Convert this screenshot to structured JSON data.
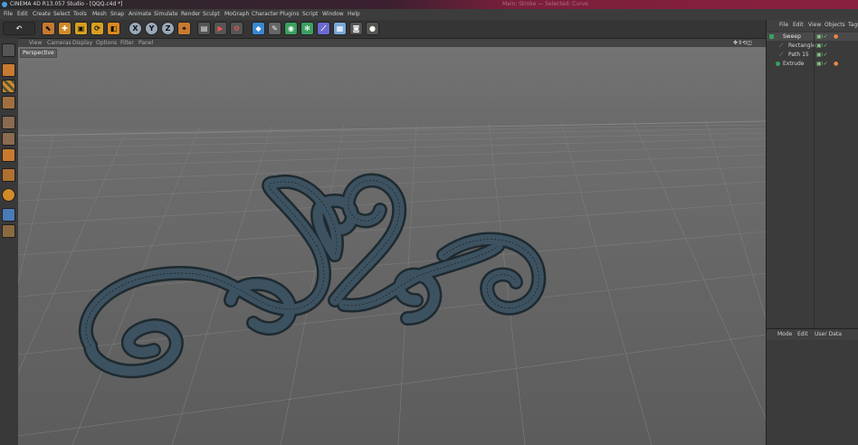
{
  "window": {
    "title": "CINEMA 4D R13.057 Studio - [QQQ.c4d *]",
    "center_title": "Main: Stroke — Selected: Curve"
  },
  "menu": [
    "File",
    "Edit",
    "Create",
    "Select",
    "Tools",
    "Mesh",
    "Snap",
    "Animate",
    "Simulate",
    "Render",
    "Sculpt",
    "MoGraph",
    "Character",
    "Plugins",
    "Script",
    "Window",
    "Help"
  ],
  "toolbar": {
    "axis_x": "X",
    "axis_y": "Y",
    "axis_z": "Z"
  },
  "viewport": {
    "menu": [
      "View",
      "Cameras",
      "Display",
      "Options",
      "Filter",
      "Panel"
    ],
    "camera_label": "Perspective"
  },
  "object_manager": {
    "menu": [
      "File",
      "Edit",
      "View",
      "Objects",
      "Tags"
    ],
    "objects": [
      {
        "name": "Sweep",
        "level": 0
      },
      {
        "name": "Rectangle",
        "level": 1
      },
      {
        "name": "Path 15",
        "level": 1
      },
      {
        "name": "Extrude",
        "level": 0
      }
    ]
  },
  "attribute_manager": {
    "menu": [
      "Mode",
      "Edit",
      "User Data"
    ]
  },
  "colors": {
    "accent_title": "#8a2040",
    "viewport_bg": "#6c6c6c",
    "model": "#2d3e48"
  }
}
